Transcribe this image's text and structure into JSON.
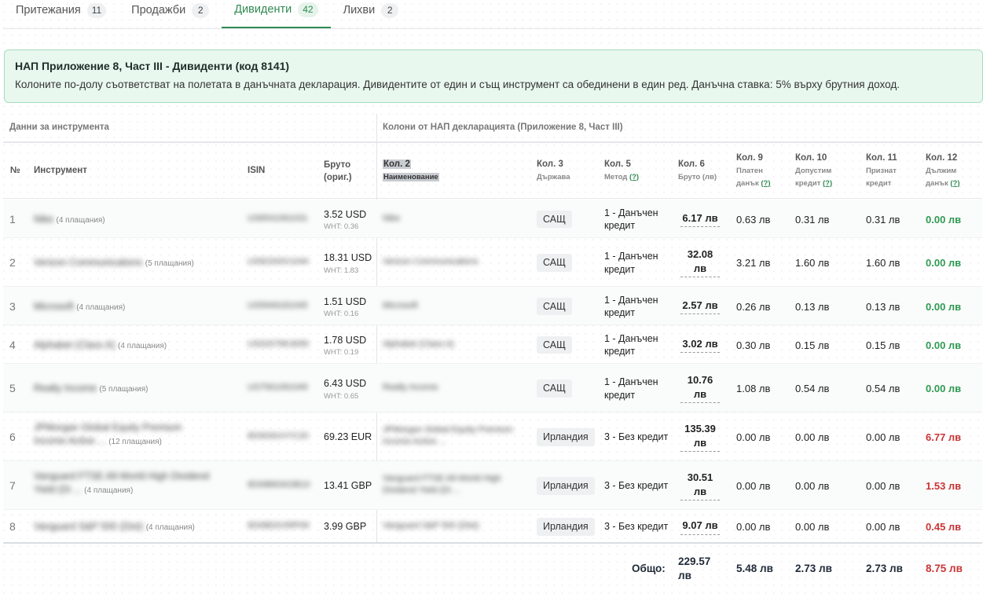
{
  "tabs": [
    {
      "label": "Притежания",
      "count": "11"
    },
    {
      "label": "Продажби",
      "count": "2"
    },
    {
      "label": "Дивиденти",
      "count": "42"
    },
    {
      "label": "Лихви",
      "count": "2"
    }
  ],
  "info": {
    "title": "НАП Приложение 8, Част III - Дивиденти (код 8141)",
    "text": "Колоните по-долу съответстват на полетата в данъчната декларация. Дивидентите от един и същ инструмент са обединени в един ред. Данъчна ставка: 5% върху брутния доход."
  },
  "groups": {
    "instrument": "Данни за инструмента",
    "nap": "Колони от НАП декларацията (Приложение 8, Част III)"
  },
  "headers": {
    "no": "№",
    "instrument": "Инструмент",
    "isin": "ISIN",
    "gross_orig": [
      "Бруто",
      "(ориг.)"
    ],
    "col2": {
      "title": "Кол. 2",
      "sub": "Наименование"
    },
    "col3": {
      "title": "Кол. 3",
      "sub": "Държава"
    },
    "col5": {
      "title": "Кол. 5",
      "sub": "Метод",
      "help": "(?)"
    },
    "col6": {
      "title": "Кол. 6",
      "sub": "Бруто (лв)"
    },
    "col9": {
      "title": "Кол. 9",
      "sub1": "Платен",
      "sub2": "данък",
      "help": "(?)"
    },
    "col10": {
      "title": "Кол. 10",
      "sub1": "Допустим",
      "sub2": "кредит",
      "help": "(?)"
    },
    "col11": {
      "title": "Кол. 11",
      "sub1": "Признат",
      "sub2": "кредит"
    },
    "col12": {
      "title": "Кол. 12",
      "sub1": "Дължим",
      "sub2": "данък",
      "help": "(?)"
    }
  },
  "rows": [
    {
      "no": "1",
      "name": "Nike",
      "payments": "(4 плащания)",
      "isin": "US6541061031",
      "gross": "3.52 USD",
      "wht": "WHT: 0.36",
      "col2": "Nike",
      "country": "САЩ",
      "method": "1 - Данъчен кредит",
      "col6": "6.17 лв",
      "col9": "0.63 лв",
      "col10": "0.31 лв",
      "col11": "0.31 лв",
      "col12": "0.00 лв",
      "status": "ok"
    },
    {
      "no": "2",
      "name": "Verizon Communications",
      "payments": "(5 плащания)",
      "isin": "US92343V1044",
      "gross": "18.31 USD",
      "wht": "WHT: 1.83",
      "col2": "Verizon Communications",
      "country": "САЩ",
      "method": "1 - Данъчен кредит",
      "col6": "32.08 лв",
      "col9": "3.21 лв",
      "col10": "1.60 лв",
      "col11": "1.60 лв",
      "col12": "0.00 лв",
      "status": "ok"
    },
    {
      "no": "3",
      "name": "Microsoft",
      "payments": "(4 плащания)",
      "isin": "US5949181045",
      "gross": "1.51 USD",
      "wht": "WHT: 0.16",
      "col2": "Microsoft",
      "country": "САЩ",
      "method": "1 - Данъчен кредит",
      "col6": "2.57 лв",
      "col9": "0.26 лв",
      "col10": "0.13 лв",
      "col11": "0.13 лв",
      "col12": "0.00 лв",
      "status": "ok"
    },
    {
      "no": "4",
      "name": "Alphabet (Class A)",
      "payments": "(4 плащания)",
      "isin": "US02079K3059",
      "gross": "1.78 USD",
      "wht": "WHT: 0.19",
      "col2": "Alphabet (Class A)",
      "country": "САЩ",
      "method": "1 - Данъчен кредит",
      "col6": "3.02 лв",
      "col9": "0.30 лв",
      "col10": "0.15 лв",
      "col11": "0.15 лв",
      "col12": "0.00 лв",
      "status": "ok"
    },
    {
      "no": "5",
      "name": "Realty Income",
      "payments": "(5 плащания)",
      "isin": "US7561091049",
      "gross": "6.43 USD",
      "wht": "WHT: 0.65",
      "col2": "Realty Income",
      "country": "САЩ",
      "method": "1 - Данъчен кредит",
      "col6": "10.76 лв",
      "col9": "1.08 лв",
      "col10": "0.54 лв",
      "col11": "0.54 лв",
      "col12": "0.00 лв",
      "status": "ok"
    },
    {
      "no": "6",
      "name": "JPMorgan Global Equity Premium Income Active ...",
      "payments": "(12 плащания)",
      "isin": "IE0003UVYC20",
      "gross": "69.23 EUR",
      "wht": "",
      "col2": "JPMorgan Global Equity Premium Income Active ...",
      "country": "Ирландия",
      "method": "3 - Без кредит",
      "col6": "135.39 лв",
      "col9": "0.00 лв",
      "col10": "0.00 лв",
      "col11": "0.00 лв",
      "col12": "6.77 лв",
      "status": "bad"
    },
    {
      "no": "7",
      "name": "Vanguard FTSE All-World High Dividend Yield (Di ...",
      "payments": "(4 плащания)",
      "isin": "IE00B8GKDB10",
      "gross": "13.41 GBP",
      "wht": "",
      "col2": "Vanguard FTSE All-World High Dividend Yield (Di ...",
      "country": "Ирландия",
      "method": "3 - Без кредит",
      "col6": "30.51 лв",
      "col9": "0.00 лв",
      "col10": "0.00 лв",
      "col11": "0.00 лв",
      "col12": "1.53 лв",
      "status": "bad"
    },
    {
      "no": "8",
      "name": "Vanguard S&P 500 (Dist)",
      "payments": "(4 плащания)",
      "isin": "IE00B3XXRP09",
      "gross": "3.99 GBP",
      "wht": "",
      "col2": "Vanguard S&P 500 (Dist)",
      "country": "Ирландия",
      "method": "3 - Без кредит",
      "col6": "9.07 лв",
      "col9": "0.00 лв",
      "col10": "0.00 лв",
      "col11": "0.00 лв",
      "col12": "0.45 лв",
      "status": "bad"
    }
  ],
  "totals": {
    "label": "Общо:",
    "col6": "229.57 лв",
    "col9": "5.48 лв",
    "col10": "2.73 лв",
    "col11": "2.73 лв",
    "col12": "8.75 лв"
  }
}
